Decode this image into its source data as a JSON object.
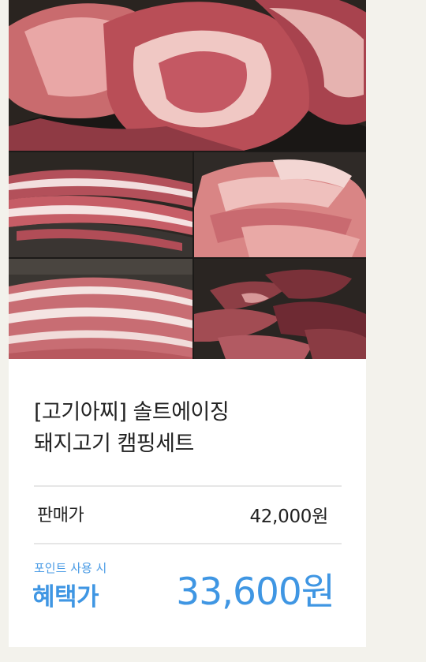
{
  "product": {
    "title_line1": "[고기아찌] 솔트에이징",
    "title_line2": "돼지고기 캠핑세트",
    "price_label": "판매가",
    "price_value": "42,000원",
    "point_note": "포인트 사용 시",
    "benefit_label": "혜택가",
    "benefit_value": "33,600원"
  },
  "images": [
    {
      "name": "pork-neck-steaks"
    },
    {
      "name": "pork-belly-slices"
    },
    {
      "name": "pork-jowl-strips"
    },
    {
      "name": "thick-pork-belly"
    },
    {
      "name": "marinated-pork-chunks"
    }
  ],
  "colors": {
    "background": "#f3f2ec",
    "card": "#ffffff",
    "accent_blue": "#3f96e3",
    "text_dark": "#222222",
    "divider": "#e6e6e6"
  }
}
